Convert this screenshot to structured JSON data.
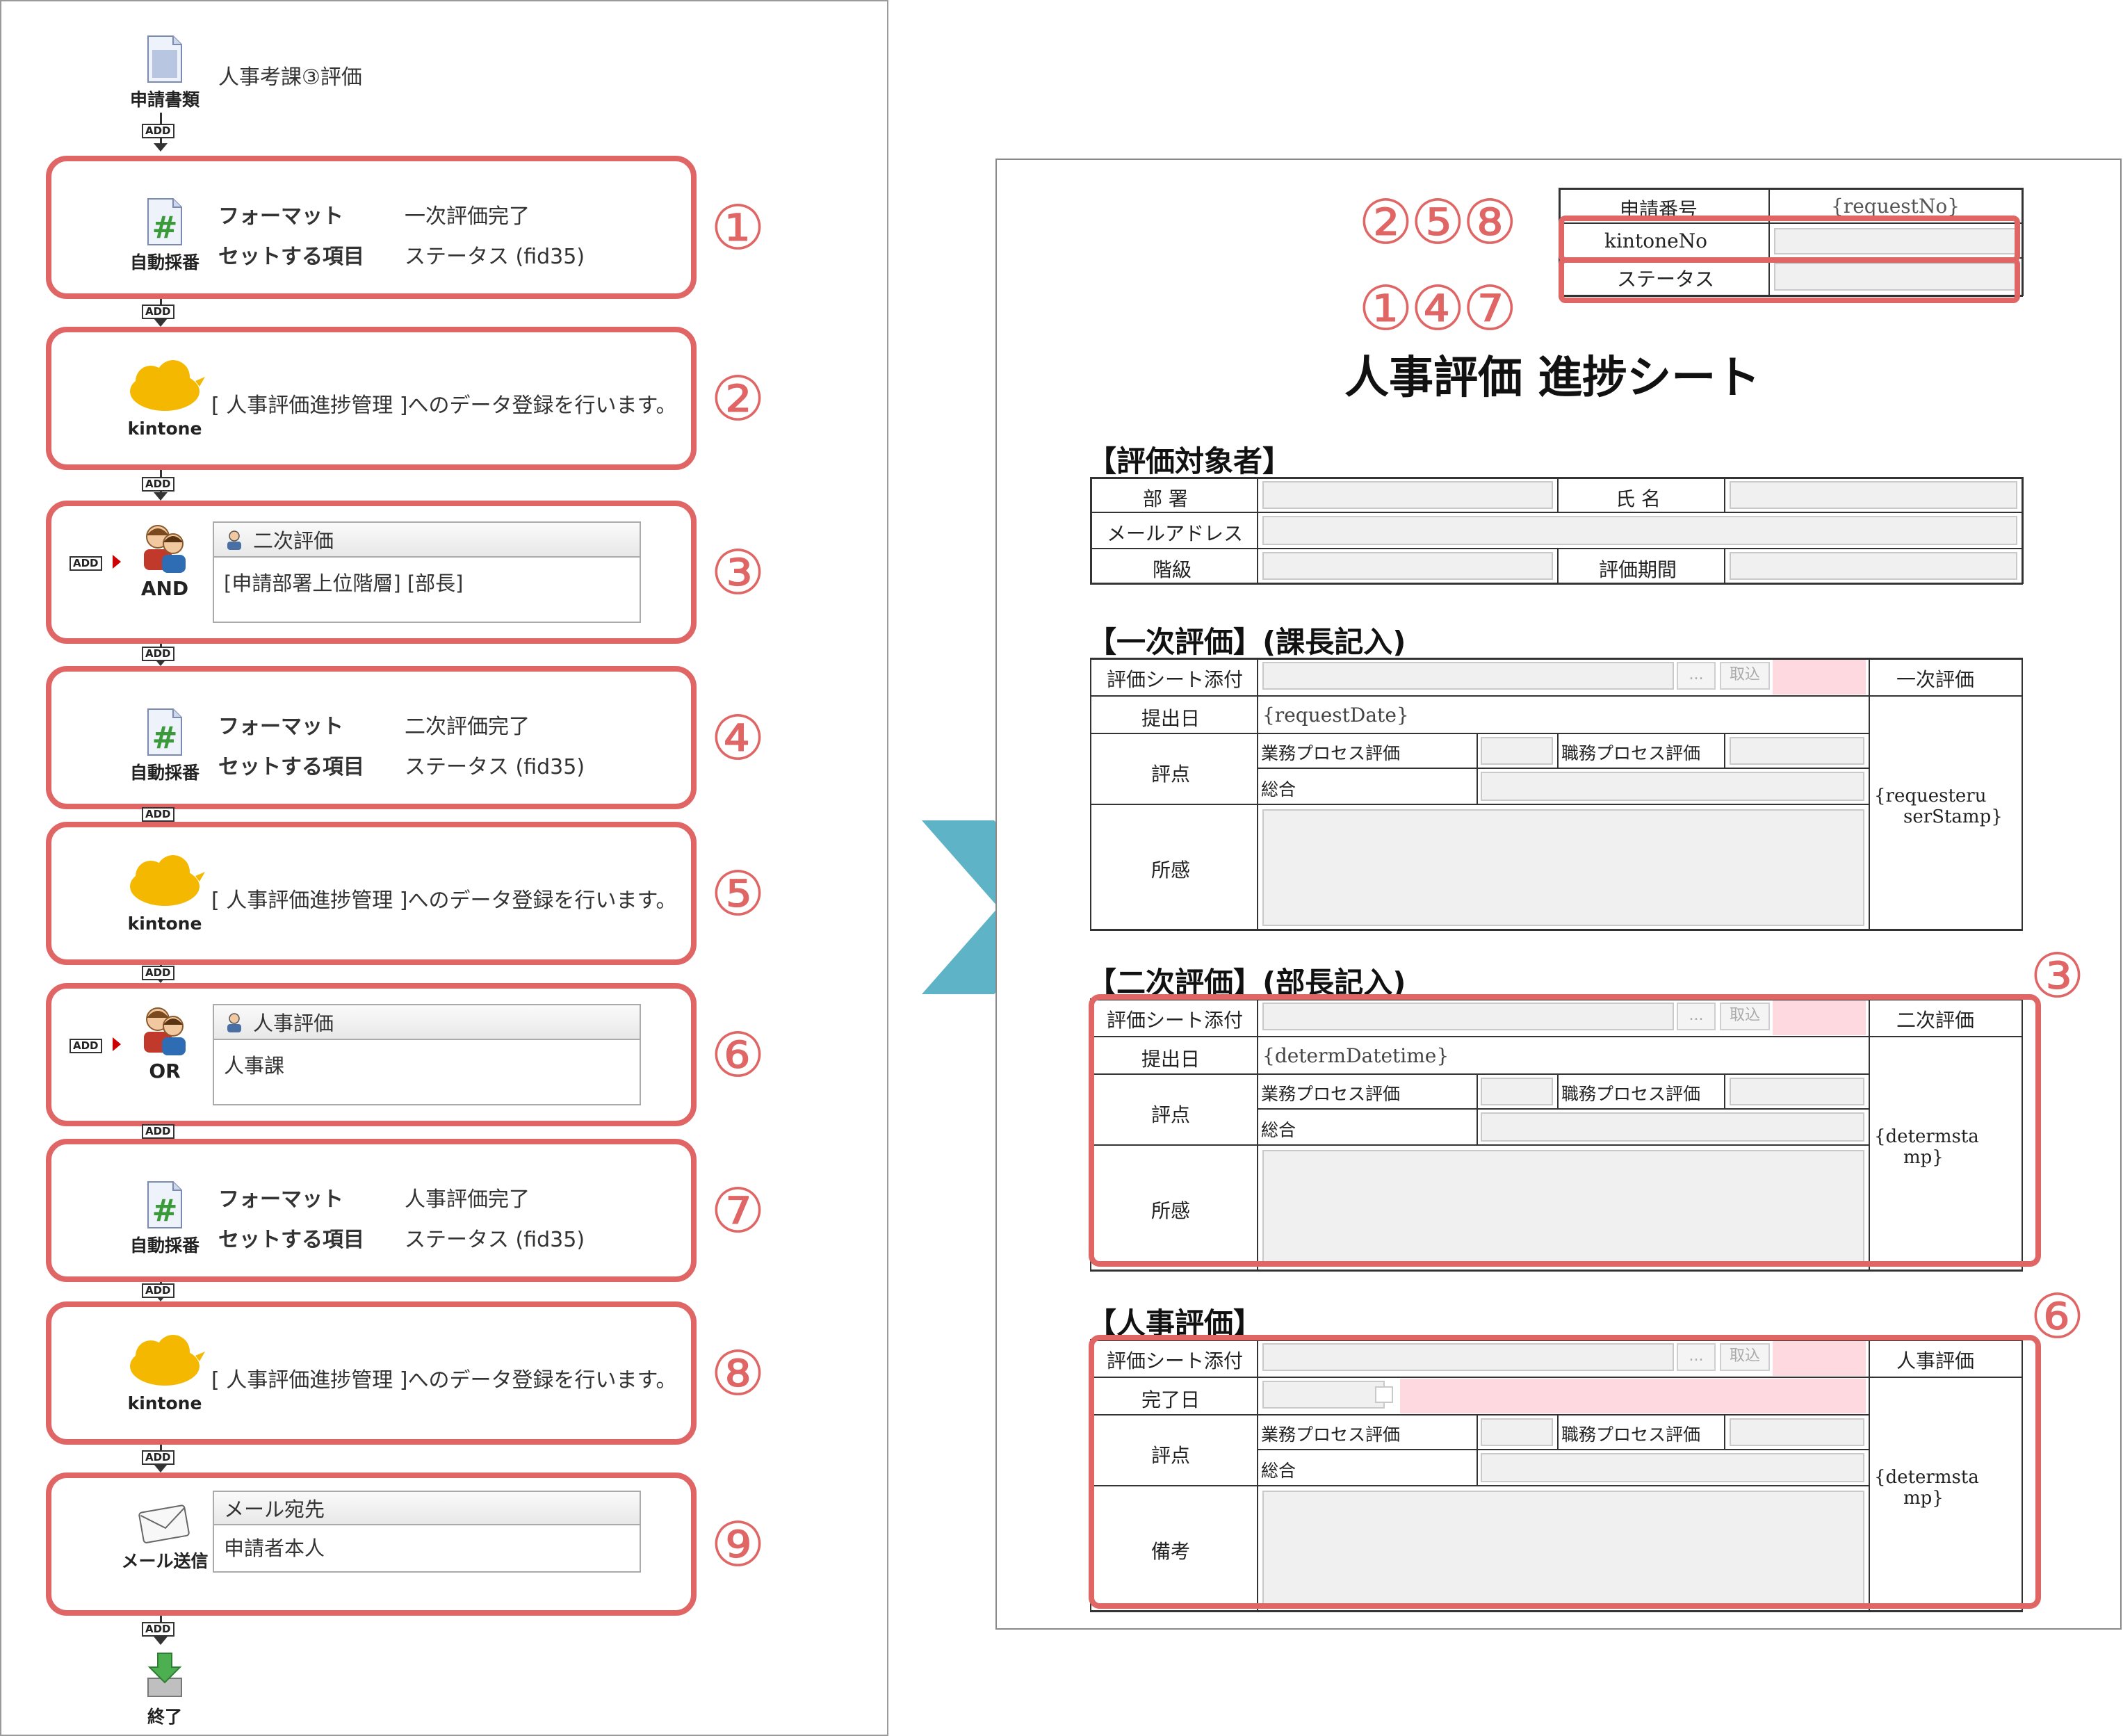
{
  "flow": {
    "start": {
      "icon": "document-icon",
      "label": "申請書類",
      "name": "人事考課③評価"
    },
    "add_label": "ADD",
    "steps": [
      {
        "num": "①",
        "type": "auto-number",
        "label": "自動採番",
        "key1": "フォーマット",
        "val1": "一次評価完了",
        "key2": "セットする項目",
        "val2": "ステータス (fid35)"
      },
      {
        "num": "②",
        "type": "kintone",
        "label": "kintone",
        "text": "[ 人事評価進捗管理 ]へのデータ登録を行います。"
      },
      {
        "num": "③",
        "type": "approver",
        "label": "AND",
        "head": "二次評価",
        "body": "[申請部署上位階層] [部長]"
      },
      {
        "num": "④",
        "type": "auto-number",
        "label": "自動採番",
        "key1": "フォーマット",
        "val1": "二次評価完了",
        "key2": "セットする項目",
        "val2": "ステータス (fid35)"
      },
      {
        "num": "⑤",
        "type": "kintone",
        "label": "kintone",
        "text": "[ 人事評価進捗管理 ]へのデータ登録を行います。"
      },
      {
        "num": "⑥",
        "type": "approver",
        "label": "OR",
        "head": "人事評価",
        "body": "人事課"
      },
      {
        "num": "⑦",
        "type": "auto-number",
        "label": "自動採番",
        "key1": "フォーマット",
        "val1": "人事評価完了",
        "key2": "セットする項目",
        "val2": "ステータス (fid35)"
      },
      {
        "num": "⑧",
        "type": "kintone",
        "label": "kintone",
        "text": "[ 人事評価進捗管理 ]へのデータ登録を行います。"
      },
      {
        "num": "⑨",
        "type": "mail",
        "label": "メール送信",
        "head": "メール宛先",
        "body": "申請者本人"
      }
    ],
    "end": {
      "label": "終了"
    }
  },
  "form": {
    "title": "人事評価 進捗シート",
    "header_nums": {
      "top": "②⑤⑧",
      "bottom": "①④⑦"
    },
    "header_table": {
      "request_no_label": "申請番号",
      "request_no_value": "{requestNo}",
      "kintone_label": "kintoneNo",
      "status_label": "ステータス"
    },
    "target": {
      "section": "【評価対象者】",
      "dept": "部 署",
      "name": "氏 名",
      "email": "メールアドレス",
      "grade": "階級",
      "period": "評価期間"
    },
    "first": {
      "section": "【一次評価】(課長記入)",
      "attach": "評価シート添付",
      "dots": "...",
      "upload": "取込",
      "stamp_label": "一次評価",
      "date_label": "提出日",
      "date_value": "{requestDate}",
      "score": "評点",
      "biz": "業務プロセス評価",
      "job": "職務プロセス評価",
      "total": "総合",
      "comment": "所感",
      "stamp": "{requesteru serStamp}",
      "stamp_l1": "{requesteru",
      "stamp_l2": "serStamp}"
    },
    "second": {
      "section": "【二次評価】(部長記入)",
      "num": "③",
      "attach": "評価シート添付",
      "dots": "...",
      "upload": "取込",
      "stamp_label": "二次評価",
      "date_label": "提出日",
      "date_value": "{determDatetime}",
      "score": "評点",
      "biz": "業務プロセス評価",
      "job": "職務プロセス評価",
      "total": "総合",
      "comment": "所感",
      "stamp_l1": "{determsta",
      "stamp_l2": "mp}"
    },
    "hr": {
      "section": "【人事評価】",
      "num": "⑥",
      "attach": "評価シート添付",
      "dots": "...",
      "upload": "取込",
      "stamp_label": "人事評価",
      "date_label": "完了日",
      "score": "評点",
      "biz": "業務プロセス評価",
      "job": "職務プロセス評価",
      "total": "総合",
      "comment": "備考",
      "stamp_l1": "{determsta",
      "stamp_l2": "mp}"
    }
  },
  "colors": {
    "highlight": "#e06666",
    "arrow": "#5fb3c6",
    "pink": "#ffd9e0"
  }
}
